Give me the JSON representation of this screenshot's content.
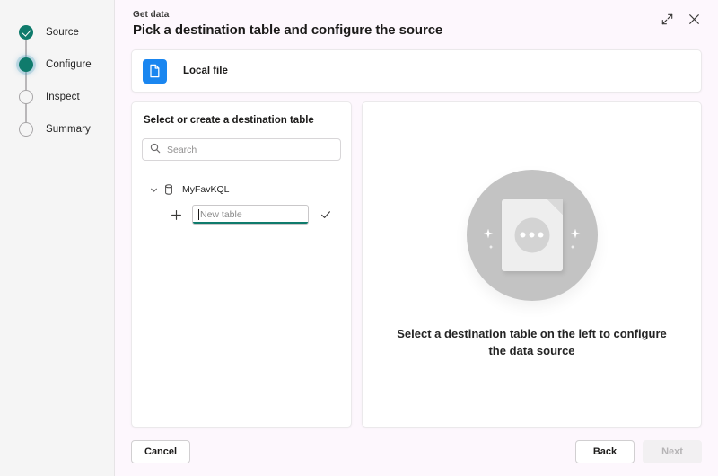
{
  "window": {
    "eyebrow": "Get data",
    "title": "Pick a destination table and configure the source",
    "expand_icon": "expand-diagonal-icon",
    "close_icon": "close-icon"
  },
  "sidebar": {
    "steps": [
      {
        "label": "Source",
        "state": "done"
      },
      {
        "label": "Configure",
        "state": "active"
      },
      {
        "label": "Inspect",
        "state": "pending"
      },
      {
        "label": "Summary",
        "state": "pending"
      }
    ]
  },
  "source_card": {
    "icon": "file-document-icon",
    "label": "Local file",
    "icon_color": "#1a86f0"
  },
  "destination_panel": {
    "heading": "Select or create a destination table",
    "search": {
      "placeholder": "Search",
      "value": "",
      "icon": "search-icon"
    },
    "tree": [
      {
        "label": "MyFavKQL",
        "icon": "database-icon",
        "chevron": "chevron-down-icon",
        "expanded": true,
        "children": [
          {
            "type": "new-table-input",
            "add_icon": "plus-icon",
            "placeholder": "New table",
            "value": "",
            "focused": true,
            "focus_color": "#0f7b6c",
            "confirm_icon": "checkmark-icon"
          }
        ]
      }
    ]
  },
  "preview_panel": {
    "illustration": "document-placeholder-illustration",
    "empty_message": "Select a destination table on the left to configure the data source"
  },
  "footer": {
    "cancel_label": "Cancel",
    "back_label": "Back",
    "next_label": "Next",
    "next_disabled": true
  },
  "colors": {
    "accent_teal": "#0f7b6c",
    "accent_blue": "#1a86f0",
    "sidebar_bg": "#f5f5f5",
    "main_bg": "#fdf7fd",
    "card_bg": "#ffffff"
  }
}
